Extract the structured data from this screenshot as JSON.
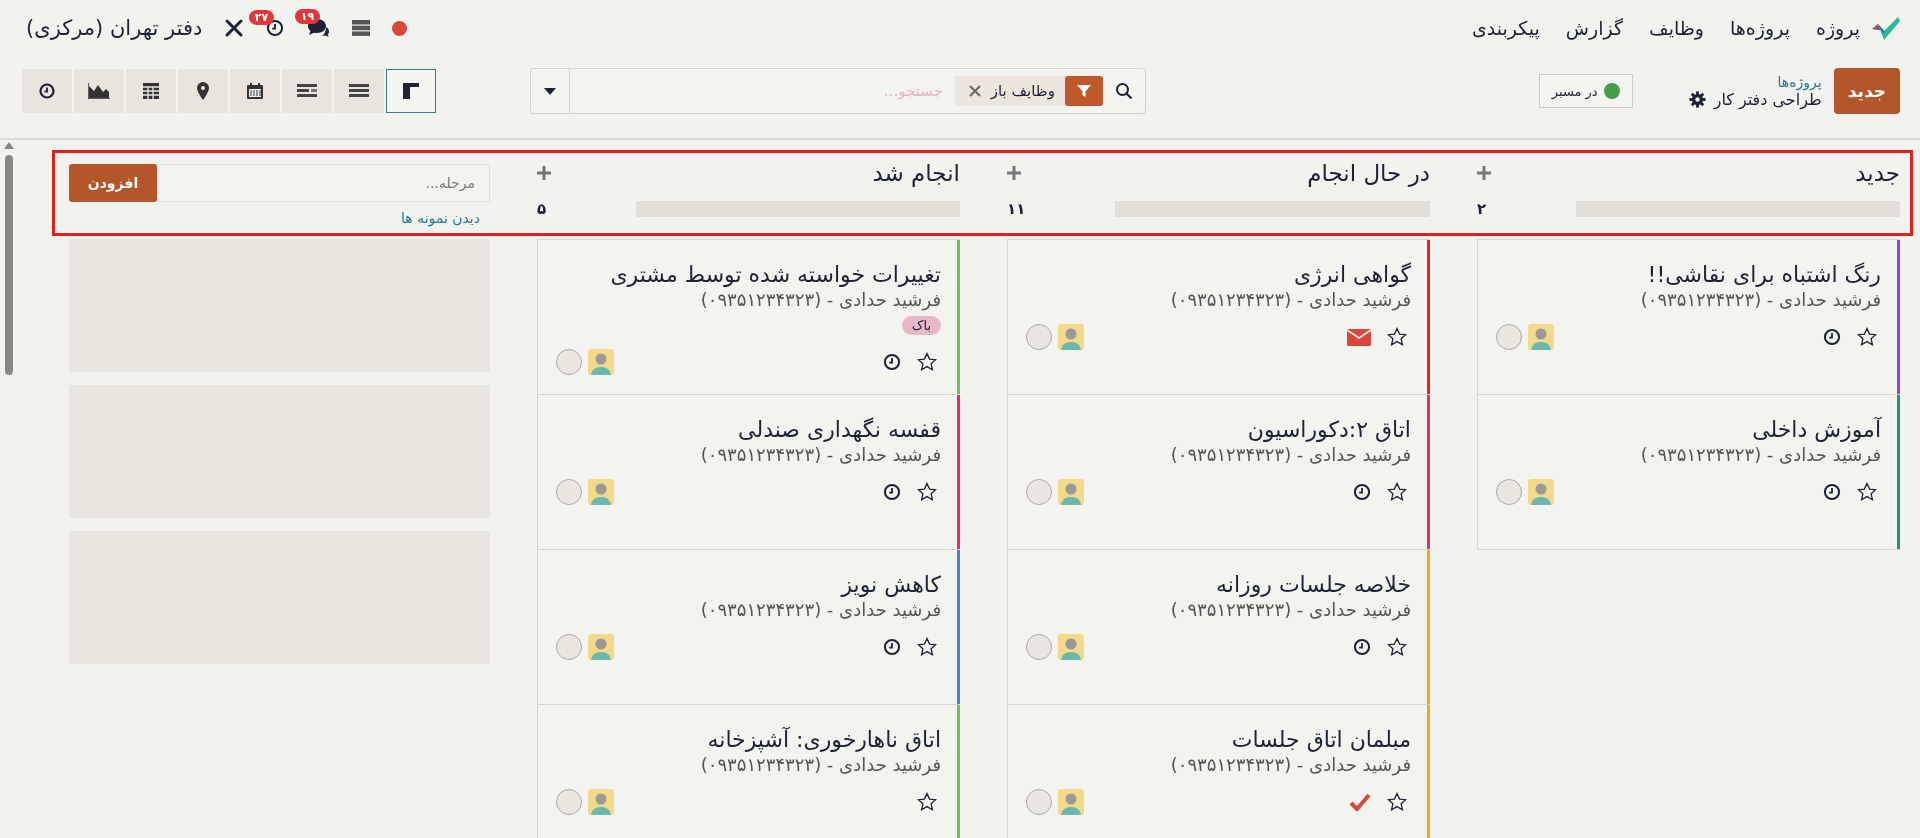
{
  "navbar": {
    "app_name": "پروژه",
    "menus": [
      "پروژه‌ها",
      "وظایف",
      "گزارش",
      "پیکربندی"
    ],
    "company": "دفتر تهران (مرکزی)",
    "activity_count": "۲۷",
    "message_count": "۱۹"
  },
  "control_panel": {
    "create_button": "جدید",
    "breadcrumb": [
      "پروژه‌ها",
      "طراحی دفتر کار"
    ],
    "toggle": {
      "label": "در مسبر",
      "color": "#43a047"
    },
    "search": {
      "placeholder": "جستجو...",
      "facets": [
        {
          "label": "وظایف باز"
        }
      ]
    },
    "views": [
      {
        "kind": "kanban",
        "selected": true
      },
      {
        "kind": "list",
        "selected": false
      },
      {
        "kind": "gantt",
        "selected": false
      },
      {
        "kind": "calendar",
        "selected": false
      },
      {
        "kind": "map",
        "selected": false
      },
      {
        "kind": "pivot",
        "selected": false
      },
      {
        "kind": "graph",
        "selected": false
      },
      {
        "kind": "activity",
        "selected": false
      }
    ]
  },
  "columns": [
    {
      "title": "جدید",
      "count": "۲",
      "level": 0,
      "cards": [
        {
          "title": "رنگ اشتباه برای نقاشی!!",
          "subtitle": "فرشید حدادی - (۰۹۳۵۱۲۳۴۳۲۳)",
          "color": "#8e44ec",
          "kind": "clock",
          "starred": false
        },
        {
          "title": "آموزش داخلی",
          "subtitle": "فرشید حدادی - (۰۹۳۵۱۲۳۴۳۲۳)",
          "color": "#2e8b7a",
          "kind": "clock",
          "starred": false
        }
      ]
    },
    {
      "title": "در حال انجام",
      "count": "۱۱",
      "level": 0,
      "cards": [
        {
          "title": "گواهی انرژی",
          "subtitle": "فرشید حدادی - (۰۹۳۵۱۲۳۴۳۲۳)",
          "color": "#e02424",
          "kind": "mail",
          "starred": false
        },
        {
          "title": "اتاق ۲:دکوراسیون",
          "subtitle": "فرشید حدادی - (۰۹۳۵۱۲۳۴۳۲۳)",
          "color": "#e0306a",
          "kind": "clock",
          "starred": false
        },
        {
          "title": "خلاصه جلسات روزانه",
          "subtitle": "فرشید حدادی - (۰۹۳۵۱۲۳۴۳۲۳)",
          "color": "#e8a92a",
          "kind": "clock",
          "starred": false
        },
        {
          "title": "مبلمان اتاق جلسات",
          "subtitle": "فرشید حدادی - (۰۹۳۵۱۲۳۴۳۲۳)",
          "color": "#e8a92a",
          "kind": "done",
          "starred": false
        }
      ]
    },
    {
      "title": "انجام شد",
      "count": "۵",
      "level": 0,
      "cards": [
        {
          "title": "تغییرات خواسته شده توسط مشتری",
          "subtitle": "فرشید حدادی - (۰۹۳۵۱۲۳۴۳۲۳)",
          "color": "#6fbf5a",
          "kind": "clock",
          "starred": false,
          "tags": [
            {
              "label": "باک",
              "color": "#e8b8c8"
            }
          ]
        },
        {
          "title": "قفسه نگهداری صندلی",
          "subtitle": "فرشید حدادی - (۰۹۳۵۱۲۳۴۳۲۳)",
          "color": "#e0306a",
          "kind": "clock",
          "starred": false
        },
        {
          "title": "کاهش نویز",
          "subtitle": "فرشید حدادی - (۰۹۳۵۱۲۳۴۳۲۳)",
          "color": "#4a7fd4",
          "kind": "clock",
          "starred": false
        },
        {
          "title": "اتاق ناهارخوری: آشپزخانه",
          "subtitle": "فرشید حدادی - (۰۹۳۵۱۲۳۴۳۲۳)",
          "color": "#6fbf5a",
          "kind": "none",
          "starred": false
        }
      ]
    }
  ],
  "quick_create": {
    "placeholder": "مرحله...",
    "button": "افزودن",
    "link": "دیدن نمونه ها"
  }
}
